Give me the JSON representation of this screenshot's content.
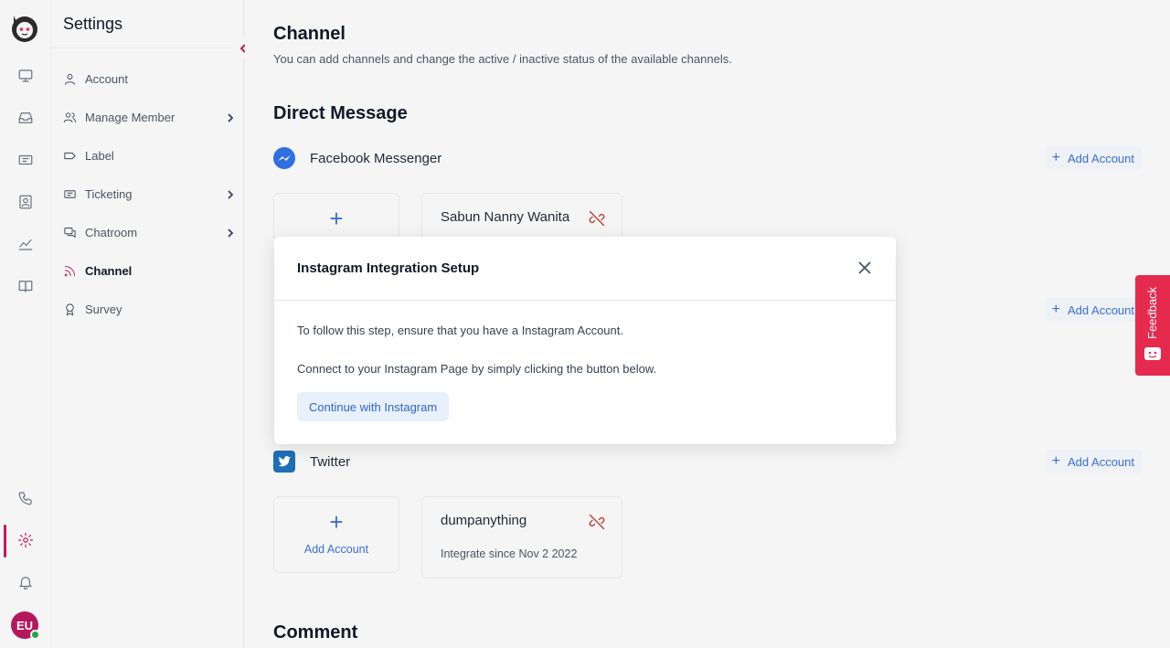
{
  "rail": {
    "avatar_initials": "EU"
  },
  "sidebar": {
    "title": "Settings",
    "items": [
      {
        "label": "Account",
        "icon": "user-icon",
        "has_children": false
      },
      {
        "label": "Manage Member",
        "icon": "users-icon",
        "has_children": true
      },
      {
        "label": "Label",
        "icon": "tag-icon",
        "has_children": false
      },
      {
        "label": "Ticketing",
        "icon": "ticket-icon",
        "has_children": true
      },
      {
        "label": "Chatroom",
        "icon": "chat-icon",
        "has_children": true
      },
      {
        "label": "Channel",
        "icon": "rss-icon",
        "has_children": false,
        "active": true
      },
      {
        "label": "Survey",
        "icon": "award-icon",
        "has_children": false
      }
    ]
  },
  "main": {
    "title": "Channel",
    "subtitle": "You can add channels and change the active / inactive status of the available channels.",
    "direct_message_title": "Direct Message",
    "comment_title": "Comment",
    "channels": {
      "facebook": {
        "name": "Facebook Messenger",
        "add_label": "Add Account",
        "account_name": "Sabun Nanny Wanita"
      },
      "second": {
        "add_label": "Add Account"
      },
      "twitter": {
        "name": "Twitter",
        "add_label": "Add Account",
        "card_add_label": "Add Account",
        "account_name": "dumpanything",
        "account_since": "Integrate since Nov 2 2022"
      }
    }
  },
  "modal": {
    "title": "Instagram Integration Setup",
    "line1": "To follow this step, ensure that you have a Instagram Account.",
    "line2": "Connect to your Instagram Page by simply clicking the button below.",
    "button_label": "Continue with Instagram"
  },
  "feedback": {
    "label": "Feedback"
  },
  "colors": {
    "accent": "#c2185b",
    "link_blue": "#3b6fd6",
    "feedback_red": "#e52a4d",
    "twitter_blue": "#1d6fb8"
  }
}
